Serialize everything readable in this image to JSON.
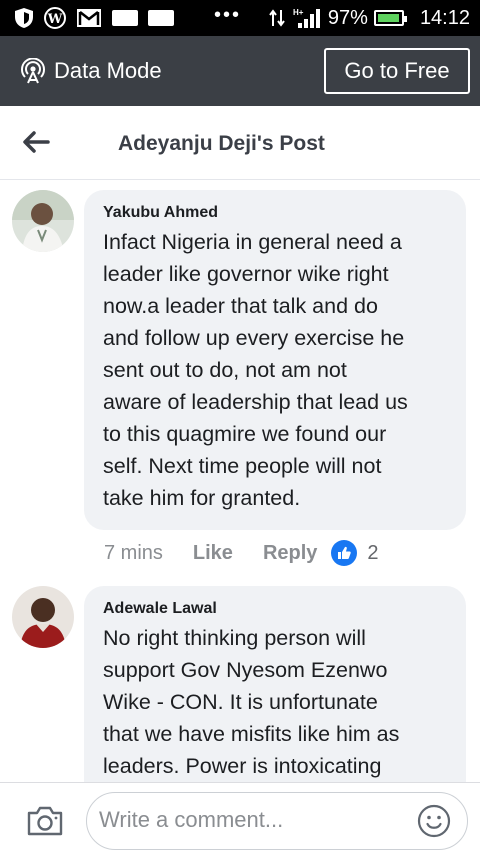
{
  "status_bar": {
    "battery": "97%",
    "time": "14:12",
    "network": "H+",
    "battery_level": 0.97
  },
  "data_mode": {
    "label": "Data Mode",
    "button": "Go to Free"
  },
  "header": {
    "title": "Adeyanju Deji's Post"
  },
  "comments": [
    {
      "author": "Yakubu Ahmed",
      "lines": [
        "Infact Nigeria in general need a",
        "leader like governor wike right",
        "now.a leader that talk and do",
        "and follow up every exercise he",
        "sent out to do, not am not",
        "aware of leadership that lead us",
        "to this quagmire we found our",
        "self. Next time people will not",
        "take him for granted."
      ],
      "time": "7 mins",
      "like_label": "Like",
      "reply_label": "Reply",
      "reaction_count": "2"
    },
    {
      "author": "Adewale Lawal",
      "lines": [
        "No right thinking person will",
        "support Gov Nyesom Ezenwo",
        "Wike - CON. It is unfortunate",
        "that we have misfits like him as",
        "leaders. Power is intoxicating"
      ]
    }
  ],
  "composer": {
    "placeholder": "Write a comment..."
  },
  "colors": {
    "status_bg": "#000000",
    "data_bar_bg": "#3b3f45",
    "bubble_bg": "#f0f2f5",
    "like_blue": "#1877f2",
    "battery_green": "#5fd35f"
  }
}
